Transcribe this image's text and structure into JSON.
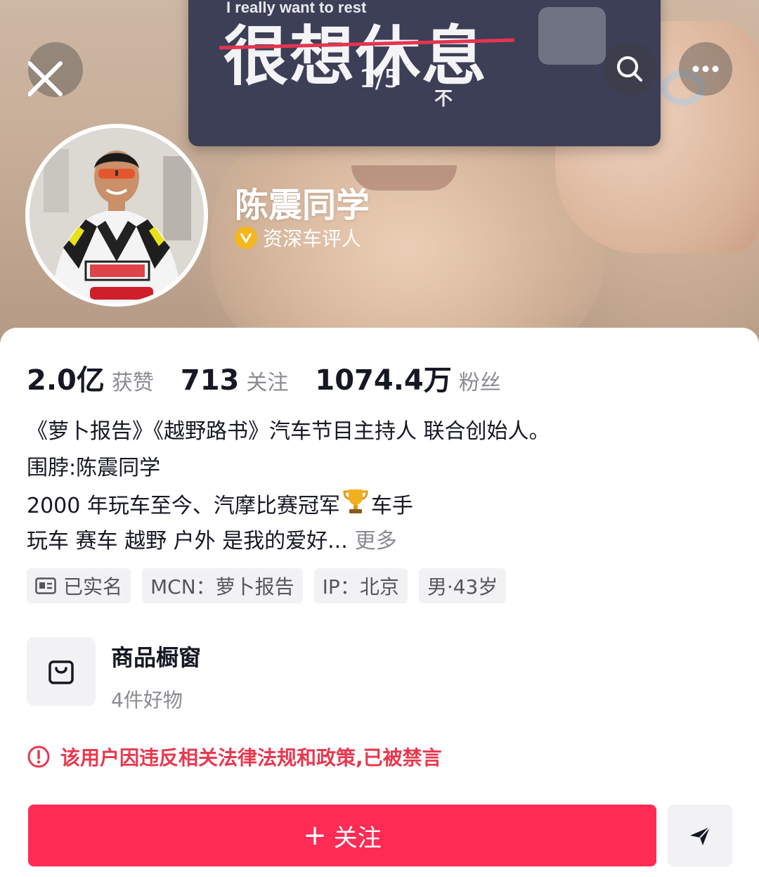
{
  "cover": {
    "card_subtitle": "I really want to rest",
    "card_title": "很想休息",
    "card_small_text": "不",
    "page_counter": "1/5"
  },
  "profile": {
    "name": "陈震同学",
    "verified_title": "资深车评人"
  },
  "stats": [
    {
      "value": "2.0亿",
      "label": "获赞"
    },
    {
      "value": "713",
      "label": "关注"
    },
    {
      "value": "1074.4万",
      "label": "粉丝"
    }
  ],
  "bio": {
    "lines": [
      "《萝卜报告》《越野路书》汽车节目主持人 联合创始人。",
      "围脖:陈震同学",
      "2000 年玩车至今、汽摩比赛冠军",
      "玩车 赛车 越野 户外 是我的爱好..."
    ],
    "line3_suffix": "车手",
    "more_label": "更多"
  },
  "tags": {
    "verified": "已实名",
    "mcn": "MCN：萝卜报告",
    "ip": "IP：北京",
    "gender_age": "男·43岁"
  },
  "shop": {
    "title": "商品橱窗",
    "subtitle": "4件好物"
  },
  "notice": {
    "ban_text": "该用户因违反相关法律法规和政策,已被禁言",
    "color": "#e8384f"
  },
  "actions": {
    "follow_label": "关注",
    "follow_color": "#fe2c55"
  },
  "icons": {
    "close": "close-icon",
    "search": "search-icon",
    "more": "more-icon",
    "verify": "verified-badge-icon",
    "trophy": "trophy-icon",
    "id_card": "id-card-icon",
    "bag": "shopping-bag-icon",
    "warning": "warning-icon",
    "share": "share-icon"
  }
}
